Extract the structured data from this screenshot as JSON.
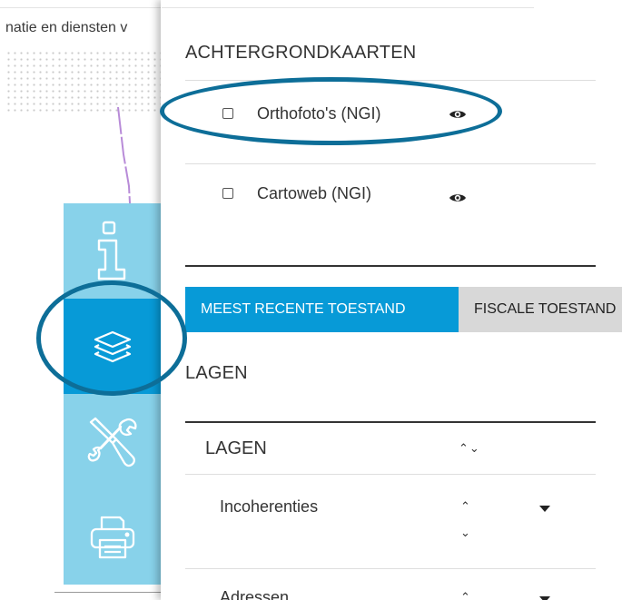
{
  "map": {
    "title_fragment": "natie en diensten v"
  },
  "toolbar": {
    "items": [
      {
        "icon": "info-icon",
        "active": false
      },
      {
        "icon": "layers-icon",
        "active": true
      },
      {
        "icon": "tools-icon",
        "active": false
      },
      {
        "icon": "printer-icon",
        "active": false
      }
    ]
  },
  "background_maps": {
    "heading": "ACHTERGRONDKAARTEN",
    "items": [
      {
        "label": "Orthofoto's (NGI)",
        "checked": false,
        "icon": "eye-icon"
      },
      {
        "label": "Cartoweb (NGI)",
        "checked": false,
        "icon": "eye-icon"
      }
    ]
  },
  "tabs": [
    {
      "label": "MEEST RECENTE TOESTAND",
      "active": true
    },
    {
      "label": "FISCALE TOESTAND",
      "active": false
    }
  ],
  "layers": {
    "heading": "LAGEN",
    "table_header": "LAGEN",
    "rows": [
      {
        "label": "Incoherenties"
      },
      {
        "label": "Adressen"
      }
    ]
  },
  "colors": {
    "accent": "#079ad7",
    "toolbar_bg": "#88d2ea",
    "highlight_ring": "#0d6e98"
  }
}
